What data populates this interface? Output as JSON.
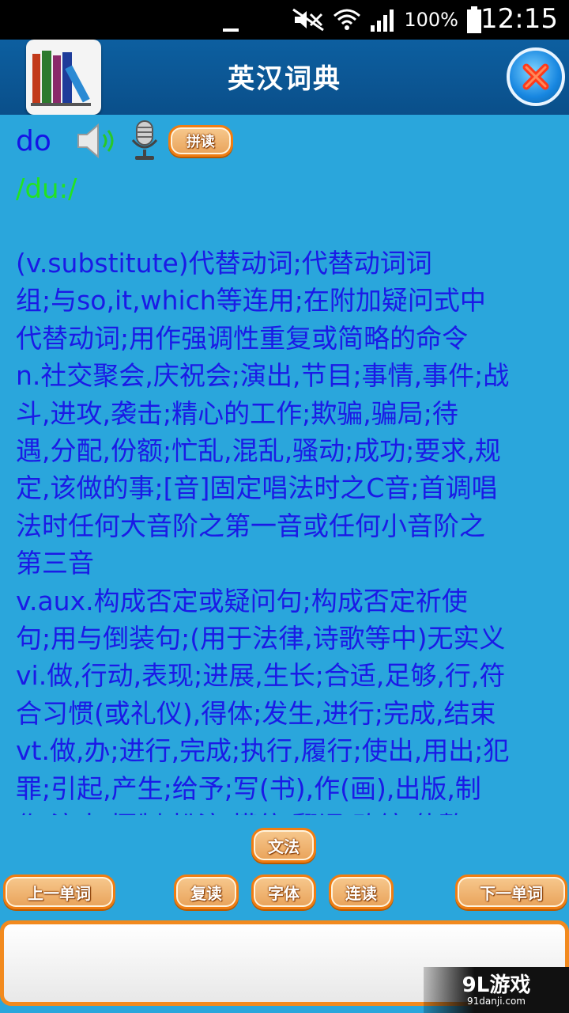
{
  "status_bar": {
    "battery_percent": "100%",
    "time": "12:15"
  },
  "header": {
    "title": "英汉词典"
  },
  "entry": {
    "word": "do",
    "phonetic": "/du:/",
    "spell_button_label": "拼读",
    "definition_lines": [
      "(v.substitute)代替动词;代替动词词",
      "组;与so,it,which等连用;在附加疑问式中",
      "代替动词;用作强调性重复或简略的命令",
      "n.社交聚会,庆祝会;演出,节目;事情,事件;战",
      "斗,进攻,袭击;精心的工作;欺骗,骗局;待",
      "遇,分配,份额;忙乱,混乱,骚动;成功;要求,规",
      "定,该做的事;[音]固定唱法时之C音;首调唱",
      "法时任何大音阶之第一音或任何小音阶之",
      "第三音",
      "v.aux.构成否定或疑问句;构成否定祈使",
      "句;用与倒装句;(用于法律,诗歌等中)无实义",
      "vi.做,行动,表现;进展,生长;合适,足够,行,符",
      "合习惯(或礼仪),得体;发生,进行;完成,结束",
      "vt.做,办;进行,完成;执行,履行;使出,用出;犯",
      "罪;引起,产生;给予;写(书),作(画),出版,制",
      "作,演出,摄制,扮演,模仿,翻译,改编,使整"
    ]
  },
  "buttons": {
    "grammar": "文法",
    "prev_word": "上一单词",
    "repeat_read": "复读",
    "font": "字体",
    "continuous_read": "连读",
    "next_word": "下一单词"
  },
  "input": {
    "value": ""
  },
  "watermark": {
    "main": "9L游戏",
    "sub": "91danji.com"
  },
  "colors": {
    "background": "#2aa6dc",
    "header": "#0d5fa0",
    "word_text": "#1414e6",
    "phonetic_text": "#22e322",
    "button_orange": "#f07d12"
  },
  "icons": [
    "mute-icon",
    "wifi-icon",
    "signal-icon",
    "battery-icon",
    "speaker-icon",
    "microphone-icon",
    "close-icon",
    "books-logo-icon"
  ]
}
